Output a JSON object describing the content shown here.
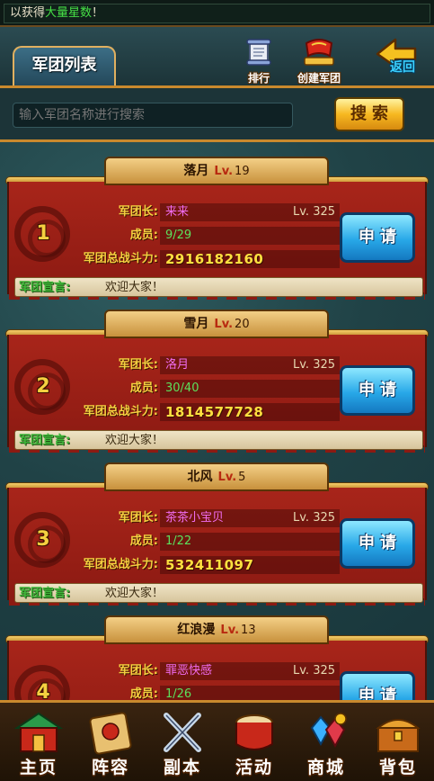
{
  "marquee": {
    "prefix": "以获得",
    "highlight": "大量星数",
    "suffix": "！"
  },
  "header": {
    "title": "军团列表",
    "rank_label": "排行",
    "create_label": "创建军团",
    "back_label": "返回"
  },
  "search": {
    "placeholder": "输入军团名称进行搜索",
    "button_label": "搜索"
  },
  "labels": {
    "leader": "军团长:",
    "members": "成员:",
    "power": "军团总战斗力:",
    "motto": "军团宣言:",
    "apply": "申请"
  },
  "legions": [
    {
      "rank": "1",
      "name": "落月",
      "lv_prefix": "Lv.",
      "lv": "19",
      "leader": "来来",
      "leader_lv": "Lv. 325",
      "members": "9/29",
      "power": "2916182160",
      "motto": "欢迎大家！"
    },
    {
      "rank": "2",
      "name": "雪月",
      "lv_prefix": "Lv.",
      "lv": "20",
      "leader": "洛月",
      "leader_lv": "Lv. 325",
      "members": "30/40",
      "power": "1814577728",
      "motto": "欢迎大家！"
    },
    {
      "rank": "3",
      "name": "北风",
      "lv_prefix": "Lv.",
      "lv": "5",
      "leader": "茶茶小宝贝",
      "leader_lv": "Lv. 325",
      "members": "1/22",
      "power": "532411097",
      "motto": "欢迎大家！"
    },
    {
      "rank": "4",
      "name": "红浪漫",
      "lv_prefix": "Lv.",
      "lv": "13",
      "leader": "罪恶快感",
      "leader_lv": "Lv. 325",
      "members": "1/26",
      "power": "",
      "motto": ""
    }
  ],
  "bottom_nav": [
    {
      "label": "主页",
      "icon": "palace-icon"
    },
    {
      "label": "阵容",
      "icon": "scroll-icon"
    },
    {
      "label": "副本",
      "icon": "crossed-swords-icon"
    },
    {
      "label": "活动",
      "icon": "drum-icon"
    },
    {
      "label": "商城",
      "icon": "gems-icon"
    },
    {
      "label": "背包",
      "icon": "treasure-chest-icon"
    }
  ]
}
